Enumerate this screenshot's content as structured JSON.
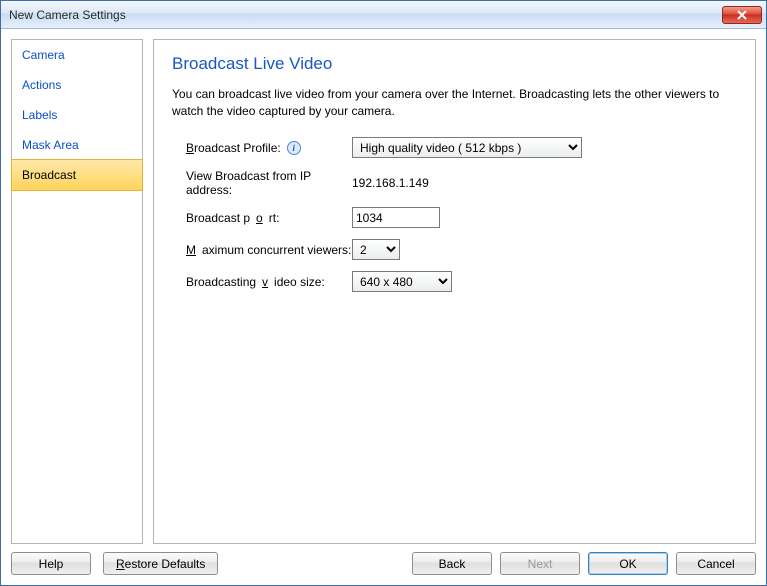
{
  "window": {
    "title": "New Camera Settings"
  },
  "sidebar": {
    "items": [
      {
        "label": "Camera",
        "selected": false
      },
      {
        "label": "Actions",
        "selected": false
      },
      {
        "label": "Labels",
        "selected": false
      },
      {
        "label": "Mask Area",
        "selected": false
      },
      {
        "label": "Broadcast",
        "selected": true
      }
    ]
  },
  "page": {
    "title": "Broadcast Live Video",
    "description": "You can broadcast live video from your camera over the Internet. Broadcasting lets the other viewers to watch the video captured by your camera."
  },
  "form": {
    "profile_label": "Broadcast Profile:",
    "profile_accel": "B",
    "profile_value": "High quality video ( 512 kbps )",
    "ip_label": "View Broadcast from IP address:",
    "ip_value": "192.168.1.149",
    "port_label": "Broadcast port:",
    "port_accel": "o",
    "port_value": "1034",
    "viewers_label": "Maximum concurrent viewers:",
    "viewers_accel": "M",
    "viewers_value": "2",
    "size_label": "Broadcasting video size:",
    "size_accel": "v",
    "size_value": "640 x 480"
  },
  "buttons": {
    "help": "Help",
    "restore": "Restore Defaults",
    "restore_accel": "R",
    "back": "Back",
    "next": "Next",
    "ok": "OK",
    "cancel": "Cancel"
  }
}
